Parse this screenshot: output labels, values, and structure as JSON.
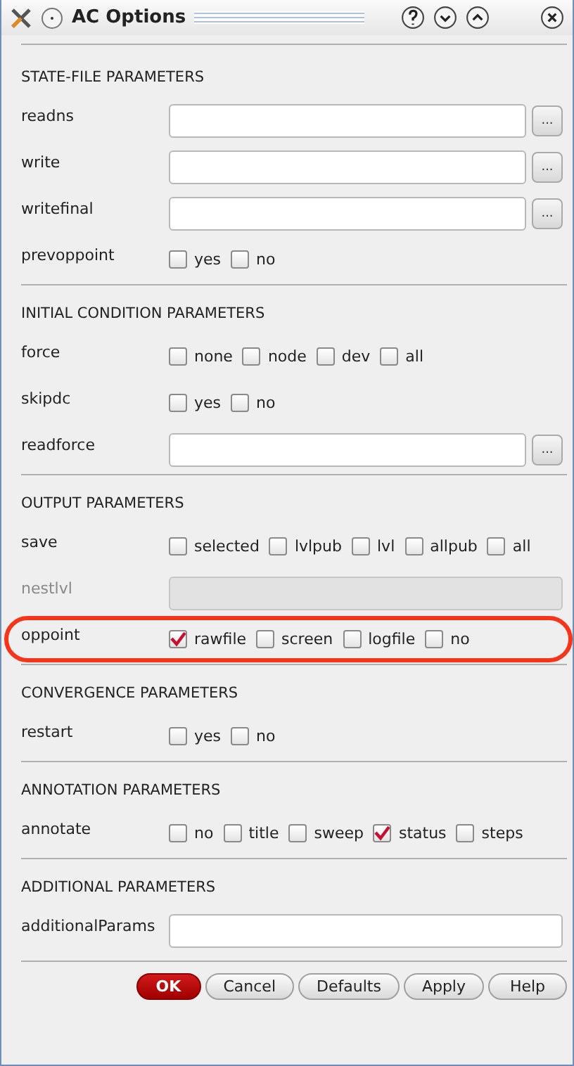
{
  "window": {
    "title": "AC Options"
  },
  "sections": [
    {
      "title": "STATE-FILE PARAMETERS",
      "rows": [
        {
          "label": "readns",
          "kind": "file",
          "disabled": false,
          "highlighted": false
        },
        {
          "label": "write",
          "kind": "file",
          "disabled": false,
          "highlighted": false
        },
        {
          "label": "writefinal",
          "kind": "file",
          "disabled": false,
          "highlighted": false
        },
        {
          "label": "prevoppoint",
          "kind": "checks",
          "disabled": false,
          "highlighted": false,
          "options": [
            {
              "label": "yes",
              "checked": false
            },
            {
              "label": "no",
              "checked": false
            }
          ]
        }
      ]
    },
    {
      "title": "INITIAL CONDITION PARAMETERS",
      "rows": [
        {
          "label": "force",
          "kind": "checks",
          "disabled": false,
          "highlighted": false,
          "options": [
            {
              "label": "none",
              "checked": false
            },
            {
              "label": "node",
              "checked": false
            },
            {
              "label": "dev",
              "checked": false
            },
            {
              "label": "all",
              "checked": false
            }
          ]
        },
        {
          "label": "skipdc",
          "kind": "checks",
          "disabled": false,
          "highlighted": false,
          "options": [
            {
              "label": "yes",
              "checked": false
            },
            {
              "label": "no",
              "checked": false
            }
          ]
        },
        {
          "label": "readforce",
          "kind": "file",
          "disabled": false,
          "highlighted": false
        }
      ]
    },
    {
      "title": "OUTPUT PARAMETERS",
      "rows": [
        {
          "label": "save",
          "kind": "checks",
          "disabled": false,
          "highlighted": false,
          "options": [
            {
              "label": "selected",
              "checked": false
            },
            {
              "label": "lvlpub",
              "checked": false
            },
            {
              "label": "lvl",
              "checked": false
            },
            {
              "label": "allpub",
              "checked": false
            },
            {
              "label": "all",
              "checked": false
            }
          ]
        },
        {
          "label": "nestlvl",
          "kind": "field",
          "disabled": true,
          "highlighted": false
        },
        {
          "label": "oppoint",
          "kind": "checks",
          "disabled": false,
          "highlighted": true,
          "options": [
            {
              "label": "rawfile",
              "checked": true
            },
            {
              "label": "screen",
              "checked": false
            },
            {
              "label": "logfile",
              "checked": false
            },
            {
              "label": "no",
              "checked": false
            }
          ]
        }
      ]
    },
    {
      "title": "CONVERGENCE PARAMETERS",
      "rows": [
        {
          "label": "restart",
          "kind": "checks",
          "disabled": false,
          "highlighted": false,
          "options": [
            {
              "label": "yes",
              "checked": false
            },
            {
              "label": "no",
              "checked": false
            }
          ]
        }
      ]
    },
    {
      "title": "ANNOTATION PARAMETERS",
      "rows": [
        {
          "label": "annotate",
          "kind": "checks",
          "disabled": false,
          "highlighted": false,
          "options": [
            {
              "label": "no",
              "checked": false
            },
            {
              "label": "title",
              "checked": false
            },
            {
              "label": "sweep",
              "checked": false
            },
            {
              "label": "status",
              "checked": true
            },
            {
              "label": "steps",
              "checked": false
            }
          ]
        }
      ]
    },
    {
      "title": "ADDITIONAL PARAMETERS",
      "rows": [
        {
          "label": "additionalParams",
          "kind": "field",
          "disabled": false,
          "highlighted": false
        }
      ]
    }
  ],
  "browse_label": "...",
  "buttons": [
    {
      "label": "OK",
      "default": true
    },
    {
      "label": "Cancel",
      "default": false
    },
    {
      "label": "Defaults",
      "default": false
    },
    {
      "label": "Apply",
      "default": false
    },
    {
      "label": "Help",
      "default": false
    }
  ]
}
